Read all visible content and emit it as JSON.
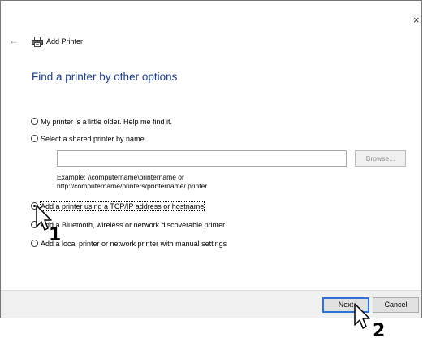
{
  "window": {
    "title": "Add Printer",
    "close_glyph": "×",
    "back_glyph": "←",
    "heading": "Find a printer by other options"
  },
  "options": {
    "older": "My printer is a little older. Help me find it.",
    "shared": "Select a shared printer by name",
    "tcpip": "Add a printer using a TCP/IP address or hostname",
    "bluetooth": "Add a Bluetooth, wireless or network discoverable printer",
    "local": "Add a local printer or network printer with manual settings",
    "selected": "tcpip"
  },
  "shared_printer": {
    "value": "",
    "browse_label": "Browse...",
    "example_line1": "Example: \\\\computername\\printername or",
    "example_line2": "http://computername/printers/printername/.printer"
  },
  "buttons": {
    "next": "Next",
    "cancel": "Cancel"
  },
  "annotations": {
    "step1": "1",
    "step2": "2"
  },
  "icons": [
    "close-icon",
    "back-arrow-icon",
    "printer-icon",
    "mouse-pointer-icon"
  ]
}
